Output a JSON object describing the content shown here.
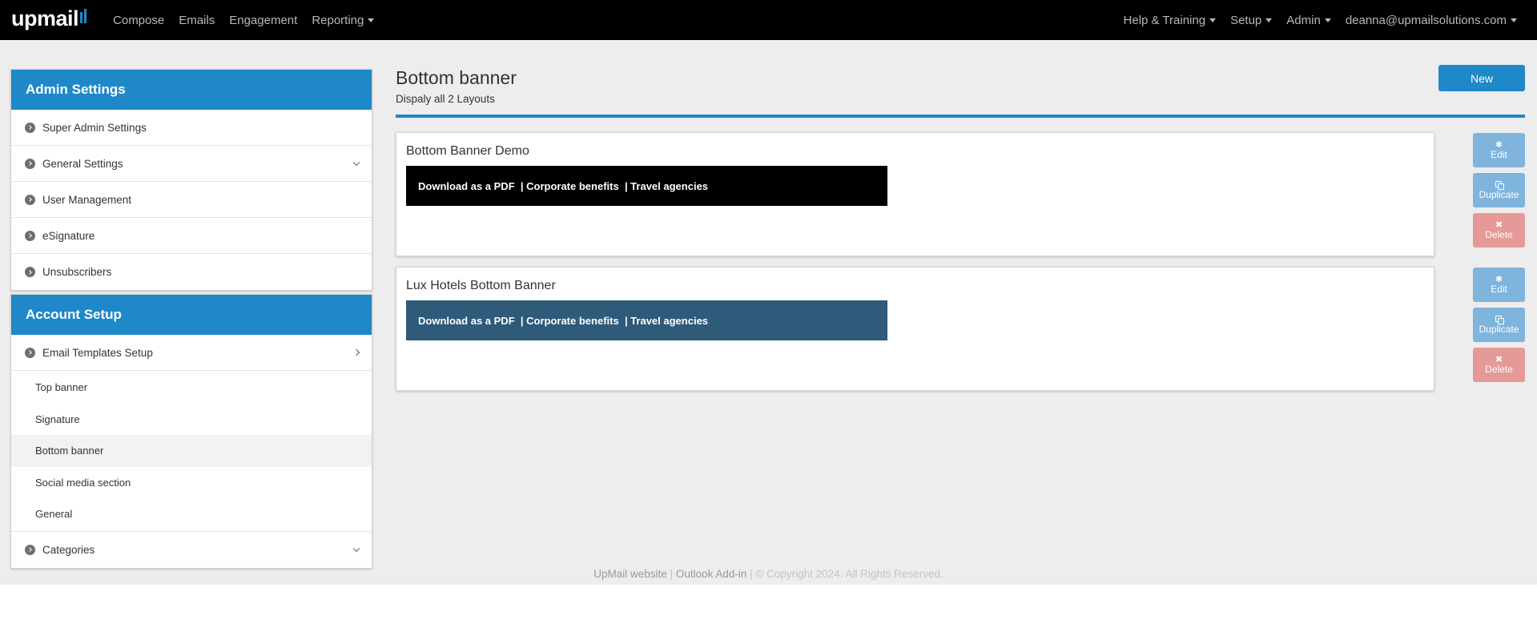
{
  "navbar": {
    "logo_text": "upmail",
    "left_items": [
      {
        "label": "Compose",
        "dropdown": false
      },
      {
        "label": "Emails",
        "dropdown": false
      },
      {
        "label": "Engagement",
        "dropdown": false
      },
      {
        "label": "Reporting",
        "dropdown": true
      }
    ],
    "right_items": [
      {
        "label": "Help & Training",
        "dropdown": true
      },
      {
        "label": "Setup",
        "dropdown": true
      },
      {
        "label": "Admin",
        "dropdown": true
      },
      {
        "label": "deanna@upmailsolutions.com",
        "dropdown": true
      }
    ]
  },
  "sidebar": {
    "admin_settings": {
      "title": "Admin Settings",
      "items": [
        "Super Admin Settings",
        "General Settings",
        "User Management",
        "eSignature",
        "Unsubscribers"
      ]
    },
    "account_setup": {
      "title": "Account Setup",
      "email_templates_label": "Email Templates Setup",
      "sub_items": [
        "Top banner",
        "Signature",
        "Bottom banner",
        "Social media section",
        "General"
      ],
      "active_sub_item": "Bottom banner",
      "categories_label": "Categories"
    }
  },
  "main": {
    "title": "Bottom banner",
    "subtitle": "Dispaly all 2 Layouts",
    "new_button": "New",
    "layouts": [
      {
        "name": "Bottom Banner Demo",
        "banner_color": "#000000",
        "links": [
          "Download as a PDF",
          "| Corporate benefits",
          "| Travel agencies"
        ]
      },
      {
        "name": "Lux Hotels Bottom Banner",
        "banner_color": "#2f5a7a",
        "links": [
          "Download as a PDF",
          "| Corporate benefits",
          "| Travel agencies"
        ]
      }
    ],
    "actions": {
      "edit": "Edit",
      "duplicate": "Duplicate",
      "delete": "Delete"
    }
  },
  "footer": {
    "website_link": "UpMail website",
    "separator": "|",
    "outlook_link": "Outlook Add-in",
    "copyright": "| © Copyright 2024. All Rights Reserved."
  },
  "colors": {
    "accent": "#1e88c9",
    "navbar_bg": "#000000",
    "content_bg": "#ededed",
    "action_blue": "#7fb4dc",
    "action_red": "#e59a98"
  }
}
